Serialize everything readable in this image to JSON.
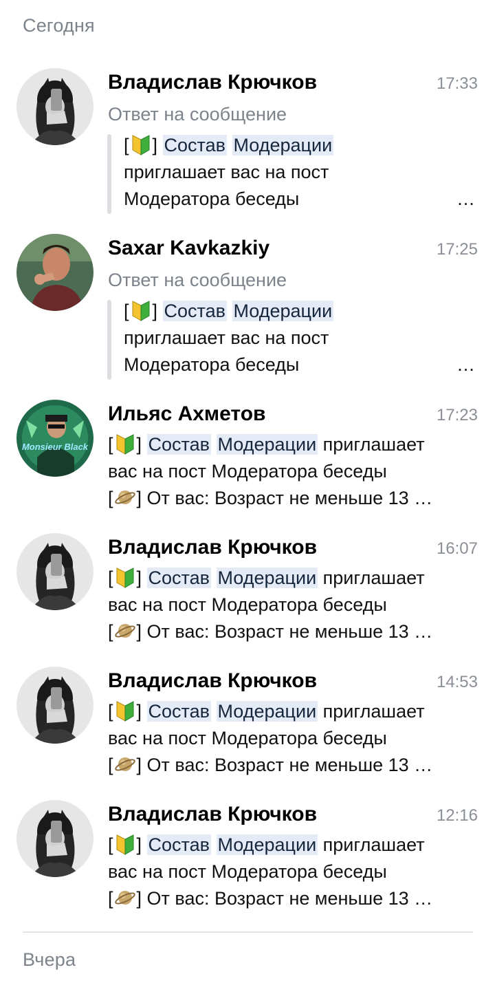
{
  "sections": {
    "today": "Сегодня",
    "yesterday": "Вчера"
  },
  "messages": [
    {
      "name": "Владислав Крючков",
      "time": "17:33",
      "reply_label": "Ответ на сообщение",
      "avatar": "girl-bw-photo",
      "bracket_open": "[",
      "bracket_close": "]",
      "hl1": "Состав",
      "hl2": "Модерации",
      "line2": "приглашает вас на пост",
      "line3": "Модератора беседы",
      "ellipsis": "…"
    },
    {
      "name": "Saxar Kavkazkiy",
      "time": "17:25",
      "reply_label": "Ответ на сообщение",
      "avatar": "man-pointing-photo",
      "bracket_open": "[",
      "bracket_close": "]",
      "hl1": "Состав",
      "hl2": "Модерации",
      "line2": "приглашает вас на пост",
      "line3": "Модератора беседы",
      "ellipsis": "…"
    },
    {
      "name": "Ильяс Ахметов",
      "time": "17:23",
      "avatar": "monsieur-black-logo",
      "avatar_text": "Monsieur Black",
      "bracket_open": "[",
      "bracket_close": "]",
      "hl1": "Состав",
      "hl2": "Модерации",
      "line1_tail": "приглашает",
      "line2": "вас на пост Модератора беседы",
      "line3": "От вас: Возраст не меньше 13 …"
    },
    {
      "name": "Владислав Крючков",
      "time": "16:07",
      "avatar": "girl-bw-photo",
      "bracket_open": "[",
      "bracket_close": "]",
      "hl1": "Состав",
      "hl2": "Модерации",
      "line1_tail": "приглашает",
      "line2": "вас на пост Модератора беседы",
      "line3": "От вас: Возраст не меньше 13 …"
    },
    {
      "name": "Владислав Крючков",
      "time": "14:53",
      "avatar": "girl-bw-photo",
      "bracket_open": "[",
      "bracket_close": "]",
      "hl1": "Состав",
      "hl2": "Модерации",
      "line1_tail": "приглашает",
      "line2": "вас на пост Модератора беседы",
      "line3": "От вас: Возраст не меньше 13 …"
    },
    {
      "name": "Владислав Крючков",
      "time": "12:16",
      "avatar": "girl-bw-photo",
      "bracket_open": "[",
      "bracket_close": "]",
      "hl1": "Состав",
      "hl2": "Модерации",
      "line1_tail": "приглашает",
      "line2": "вас на пост Модератора беседы",
      "line3": "От вас: Возраст не меньше 13 …"
    }
  ],
  "emoji": {
    "beginner": "beginner-green-yellow-shield",
    "planet": "ringed-planet"
  }
}
